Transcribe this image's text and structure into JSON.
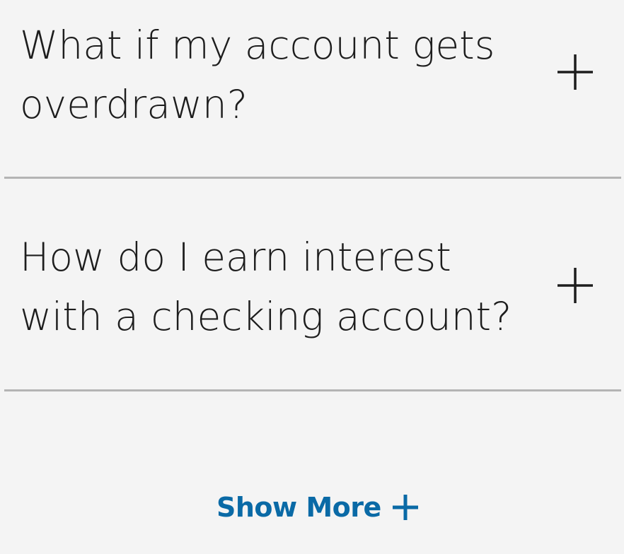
{
  "faq": {
    "items": [
      {
        "question_line1": "What if my account gets",
        "question_line2": "overdrawn?",
        "toggle_icon": "plus-icon"
      },
      {
        "question_line1": "How do I earn interest",
        "question_line2": "with a checking account?",
        "toggle_icon": "plus-icon"
      }
    ],
    "show_more_label": "Show More",
    "show_more_icon": "plus-icon",
    "colors": {
      "background": "#f4f4f4",
      "text": "#1d1d1d",
      "divider": "#b4b4b4",
      "link": "#0a6aa6"
    }
  }
}
